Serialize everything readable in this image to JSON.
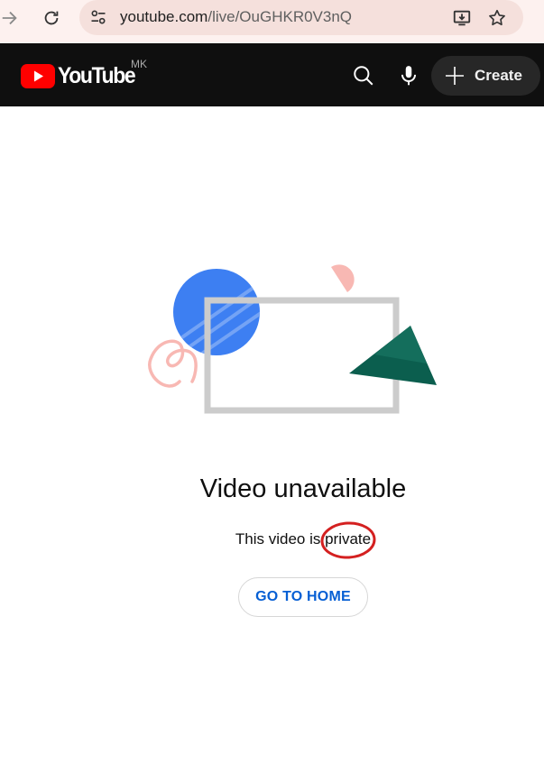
{
  "browser": {
    "url_domain": "youtube.com",
    "url_path": "/live/OuGHKR0V3nQ"
  },
  "masthead": {
    "logo_text": "YouTube",
    "country_code": "MK",
    "create_label": "Create"
  },
  "main": {
    "title": "Video unavailable",
    "message_prefix": "This video is ",
    "message_highlight": "private",
    "home_button_label": "GO TO HOME"
  },
  "icons": {
    "back": "arrow-right-icon",
    "reload": "reload-icon",
    "site_info": "tune-icon",
    "install": "install-app-icon",
    "bookmark": "star-icon",
    "search": "search-icon",
    "voice": "microphone-icon",
    "create": "plus-icon"
  },
  "colors": {
    "brand_red": "#ff0000",
    "link_blue": "#065fd4",
    "annotation_red": "#d42020"
  }
}
